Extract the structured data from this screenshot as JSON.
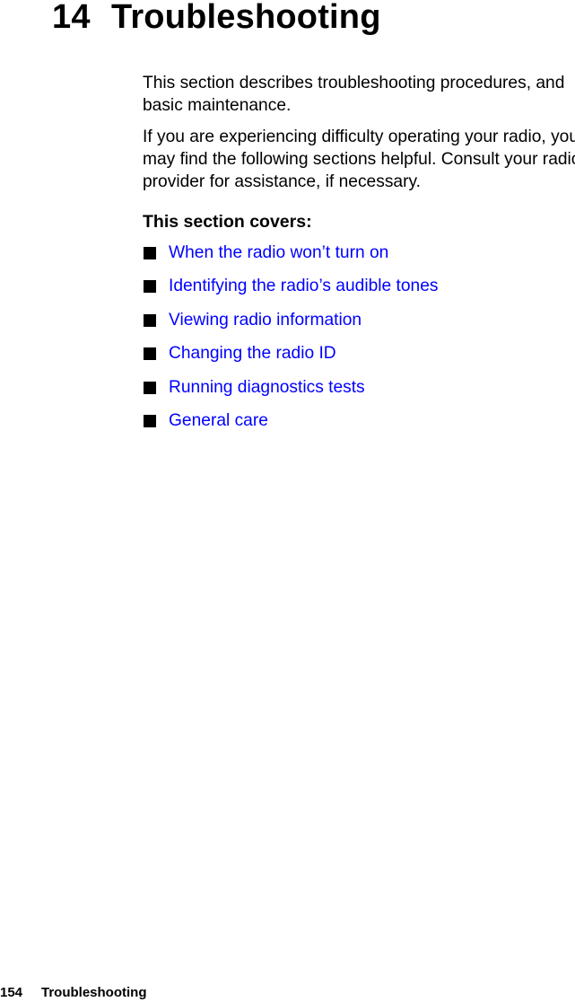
{
  "chapter": {
    "number": "14",
    "title": "Troubleshooting"
  },
  "intro": {
    "paragraph1": "This section describes troubleshooting procedures, and basic maintenance.",
    "paragraph2": "If you are experiencing difficulty operating your radio, you may find the following sections helpful. Consult your radio provider for assistance, if necessary."
  },
  "covers": {
    "heading": "This section covers:",
    "link_color": "#0000ff",
    "items": [
      {
        "label": "When the radio won’t turn on",
        "icon": "square-bullet-icon"
      },
      {
        "label": "Identifying the radio’s audible tones",
        "icon": "square-bullet-icon"
      },
      {
        "label": "Viewing radio information",
        "icon": "square-bullet-icon"
      },
      {
        "label": "Changing the radio ID",
        "icon": "square-bullet-icon"
      },
      {
        "label": "Running diagnostics tests",
        "icon": "square-bullet-icon"
      },
      {
        "label": "General care",
        "icon": "square-bullet-icon"
      }
    ]
  },
  "footer": {
    "page_number": "154",
    "section": "Troubleshooting"
  }
}
